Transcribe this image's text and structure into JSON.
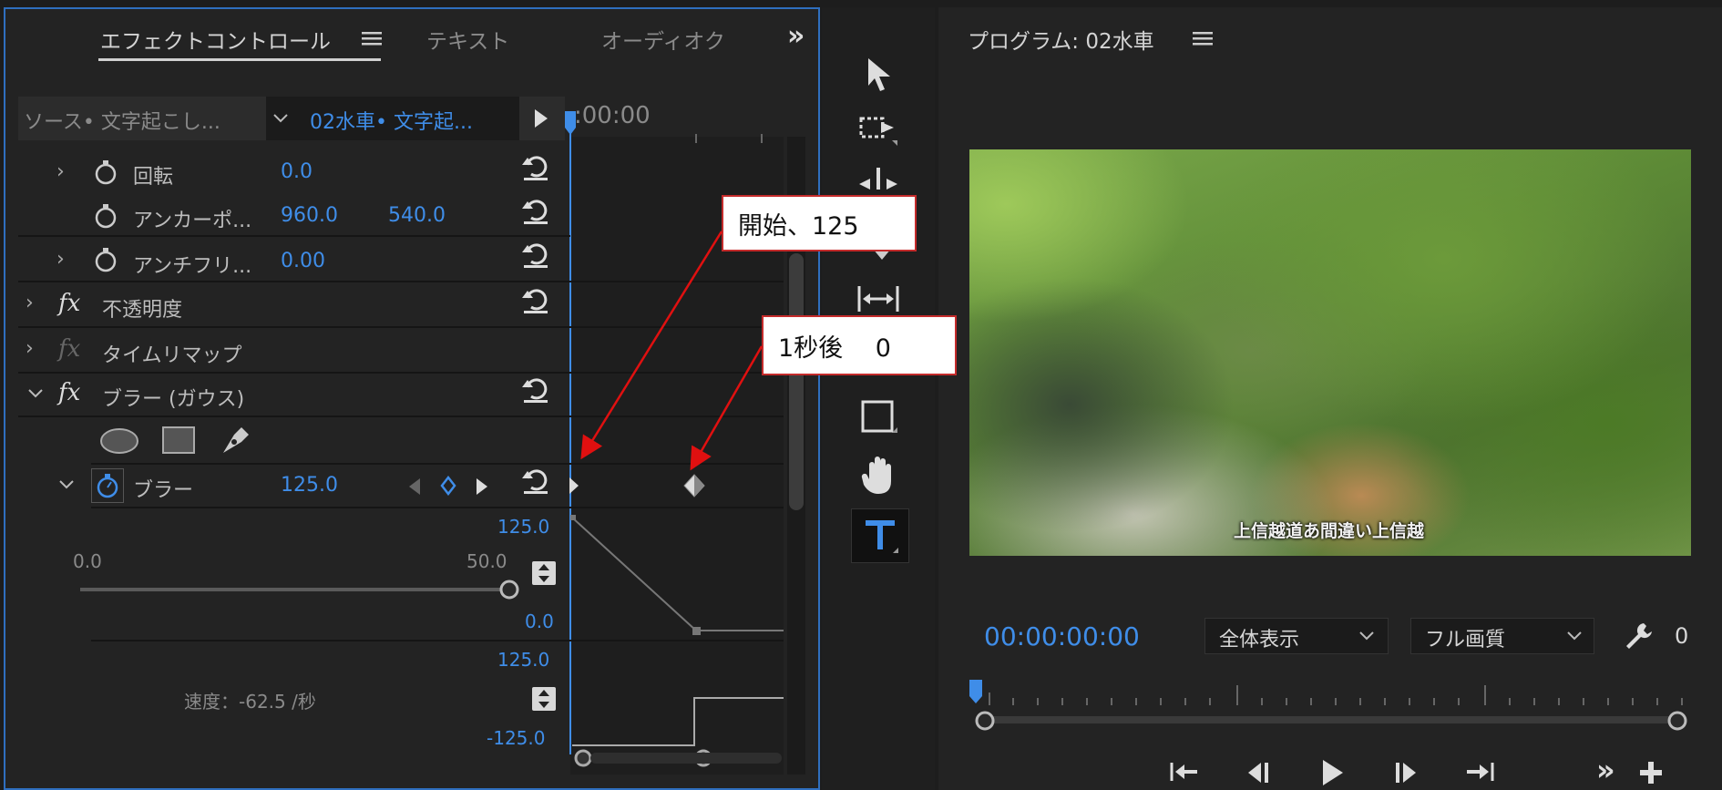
{
  "effect_panel": {
    "tabs": [
      {
        "label": "エフェクトコントロール"
      },
      {
        "label": "テキスト"
      },
      {
        "label": "オーディオク"
      }
    ],
    "overflow_label": "»",
    "source_label": "ソース• 文字起こし...",
    "clip_label": "02水車• 文字起...",
    "timecode_ruler": ":00:00",
    "rows": {
      "rotation": {
        "label": "回転",
        "value": "0.0"
      },
      "anchor": {
        "label": "アンカーポ...",
        "x": "960.0",
        "y": "540.0"
      },
      "antiflicker": {
        "label": "アンチフリ...",
        "value": "0.00"
      },
      "opacity": {
        "label": "不透明度"
      },
      "timeremap": {
        "label": "タイムリマップ"
      },
      "blur_effect": {
        "label": "ブラー (ガウス)"
      },
      "blur": {
        "label": "ブラー",
        "value": "125.0"
      }
    },
    "value_graph": {
      "max": "125.0",
      "min": "0.0",
      "slider_min": "0.0",
      "slider_max": "50.0"
    },
    "speed_graph": {
      "max": "125.0",
      "min": "-125.0",
      "speed_text": "速度：-62.5 /秒"
    },
    "keyframes_seconds": [
      0,
      1
    ],
    "blur_values_at_keyframes": [
      125,
      0
    ]
  },
  "program": {
    "title": "プログラム: 02水車",
    "timecode": "00:00:00:00",
    "fit_select": "全体表示",
    "quality_select": "フル画質",
    "trailing_value": "0",
    "subtitle": "上信越道あ間違い上信越"
  },
  "callouts": {
    "start": "開始、125",
    "after": "1秒後　 0"
  },
  "colors": {
    "accent_blue": "#3f8de8",
    "panel_bg": "#232323",
    "callout_border": "#c42b2b",
    "arrow_red": "#e01010"
  }
}
